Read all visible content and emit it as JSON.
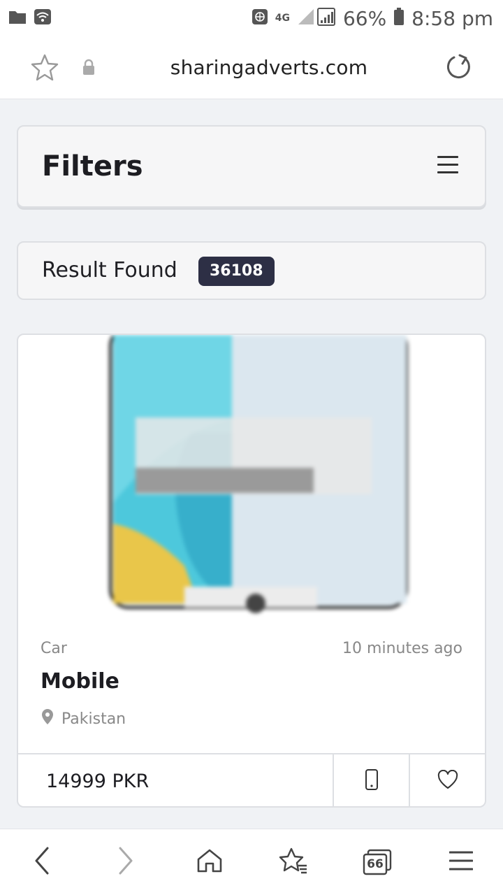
{
  "status_bar": {
    "battery": "66%",
    "time": "8:58 pm",
    "network": "4G"
  },
  "browser": {
    "url": "sharingadverts.com"
  },
  "filters": {
    "title": "Filters"
  },
  "results": {
    "label": "Result Found",
    "count": "36108"
  },
  "ad": {
    "category": "Car",
    "posted": "10 minutes ago",
    "title": "Mobile",
    "location": "Pakistan",
    "price": "14999 PKR"
  },
  "bottom_nav": {
    "tabs_count": "66"
  },
  "colors": {
    "badge_bg": "#2d2f45",
    "page_bg": "#f0f2f5"
  }
}
